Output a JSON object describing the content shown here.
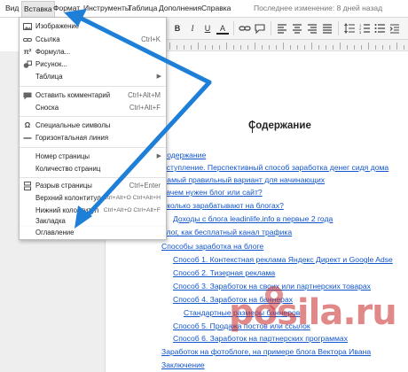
{
  "menubar": {
    "items": [
      "Вид",
      "Вставка",
      "Формат",
      "Инструменты",
      "Таблица",
      "Дополнения",
      "Справка"
    ],
    "last_edit": "Последнее изменение: 8 дней назад"
  },
  "toolbar": {
    "bold": "B",
    "italic": "I",
    "underline": "U",
    "font_color": "A"
  },
  "insert_menu": {
    "items": [
      {
        "label": "Изображение",
        "shortcut": "",
        "icon": "image-icon",
        "submenu": false
      },
      {
        "label": "Ссылка",
        "shortcut": "Ctrl+K",
        "icon": "link-icon",
        "submenu": false
      },
      {
        "label": "Формула...",
        "shortcut": "",
        "icon": "pi-icon",
        "icon_glyph": "π²",
        "submenu": false
      },
      {
        "label": "Рисунок...",
        "shortcut": "",
        "icon": "drawing-icon",
        "submenu": false
      },
      {
        "label": "Таблица",
        "shortcut": "",
        "icon": "",
        "submenu": true
      },
      {
        "label": "Оставить комментарий",
        "shortcut": "Ctrl+Alt+M",
        "icon": "comment-icon",
        "submenu": false
      },
      {
        "label": "Сноска",
        "shortcut": "Ctrl+Alt+F",
        "icon": "",
        "submenu": false
      },
      {
        "label": "Специальные символы",
        "shortcut": "",
        "icon": "omega-icon",
        "icon_glyph": "Ω",
        "submenu": false
      },
      {
        "label": "Горизонтальная линия",
        "shortcut": "",
        "icon": "hr-icon",
        "submenu": false
      },
      {
        "label": "Номер страницы",
        "shortcut": "",
        "icon": "",
        "submenu": true
      },
      {
        "label": "Количество страниц",
        "shortcut": "",
        "icon": "",
        "submenu": false
      },
      {
        "label": "Разрыв страницы",
        "shortcut": "Ctrl+Enter",
        "icon": "page-break-icon",
        "submenu": false
      },
      {
        "label": "Верхний колонтитул",
        "shortcut": "Ctrl+Alt+O Ctrl+Alt+H",
        "icon": "",
        "submenu": false
      },
      {
        "label": "Нижний колонтитул",
        "shortcut": "Ctrl+Alt+O Ctrl+Alt+F",
        "icon": "",
        "submenu": false
      },
      {
        "label": "Закладка",
        "shortcut": "",
        "icon": "",
        "submenu": false
      },
      {
        "label": "Оглавление",
        "shortcut": "",
        "icon": "",
        "submenu": false
      }
    ]
  },
  "document": {
    "heading": "Содержание",
    "toc": [
      {
        "text": "Содержание",
        "level": 0
      },
      {
        "text": "Вступление. Перспективный способ заработка денег сидя дома",
        "level": 0
      },
      {
        "text": "Самый правильный вариант для начинающих",
        "level": 0
      },
      {
        "text": "Зачем нужен блог или сайт?",
        "level": 0
      },
      {
        "text": "Сколько зарабатывают на блогах?",
        "level": 0
      },
      {
        "text": "Доходы с блога  leadinlife.info в первые 2 года",
        "level": 1
      },
      {
        "text": "Блог, как бесплатный канал трафика",
        "level": 0
      },
      {
        "text": "Способы заработка на блоге",
        "level": 0
      },
      {
        "text": "Способ 1. Контекстная реклама Яндекс Директ и Google Adse",
        "level": 1
      },
      {
        "text": "Способ 2. Тизерная реклама",
        "level": 1
      },
      {
        "text": "Способ 3. Заработок на своих или партнерских товарах",
        "level": 1
      },
      {
        "text": "Способ 4. Заработок на баннерах",
        "level": 1
      },
      {
        "text": "Стандартные размеры баннеров",
        "level": 2
      },
      {
        "text": "Способ 5. Продажа постов или ссылок",
        "level": 1
      },
      {
        "text": "Способ 6. Заработок на партнерских программах",
        "level": 1
      },
      {
        "text": "Заработок на фотоблоге, на примере блога Вектора Ивана",
        "level": 0
      },
      {
        "text": "Заключение",
        "level": 0
      }
    ]
  },
  "watermark": "posila.ru",
  "colors": {
    "link": "#1155cc",
    "arrow": "#1e7fd8",
    "watermark": "#c82828"
  }
}
